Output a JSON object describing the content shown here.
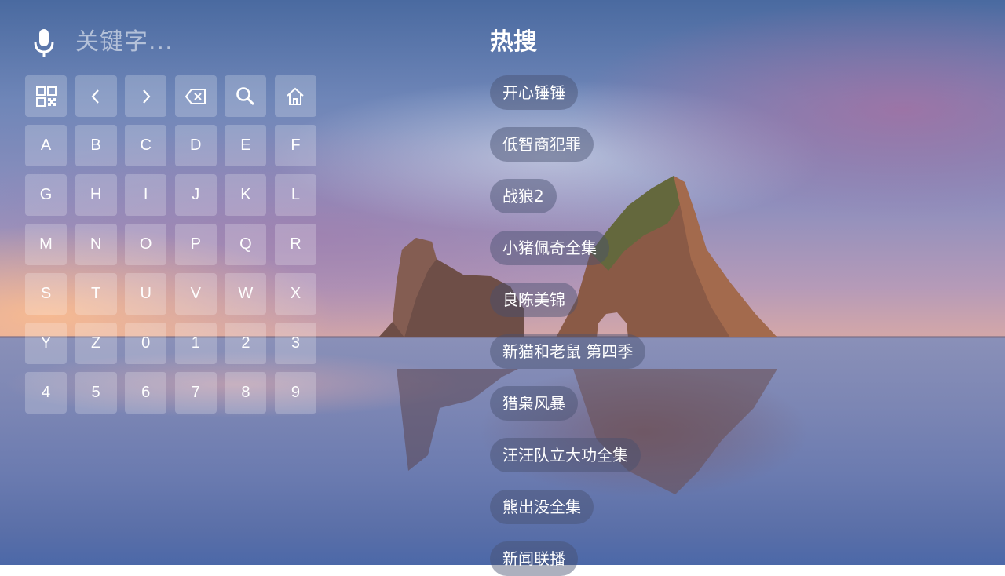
{
  "search": {
    "placeholder": "关键字..."
  },
  "keyboard": {
    "tools": [
      {
        "icon": "qr-code-icon",
        "label": ""
      },
      {
        "icon": "chevron-left-icon",
        "label": ""
      },
      {
        "icon": "chevron-right-icon",
        "label": ""
      },
      {
        "icon": "backspace-icon",
        "label": ""
      },
      {
        "icon": "search-icon",
        "label": ""
      },
      {
        "icon": "home-icon",
        "label": ""
      }
    ],
    "keys": [
      "A",
      "B",
      "C",
      "D",
      "E",
      "F",
      "G",
      "H",
      "I",
      "J",
      "K",
      "L",
      "M",
      "N",
      "O",
      "P",
      "Q",
      "R",
      "S",
      "T",
      "U",
      "V",
      "W",
      "X",
      "Y",
      "Z",
      "0",
      "1",
      "2",
      "3",
      "4",
      "5",
      "6",
      "7",
      "8",
      "9"
    ]
  },
  "hot": {
    "title": "热搜",
    "items": [
      "开心锤锤",
      "低智商犯罪",
      "战狼2",
      "小猪佩奇全集",
      "良陈美锦",
      "新猫和老鼠 第四季",
      "猎枭风暴",
      "汪汪队立大功全集",
      "熊出没全集",
      "新闻联播"
    ]
  }
}
